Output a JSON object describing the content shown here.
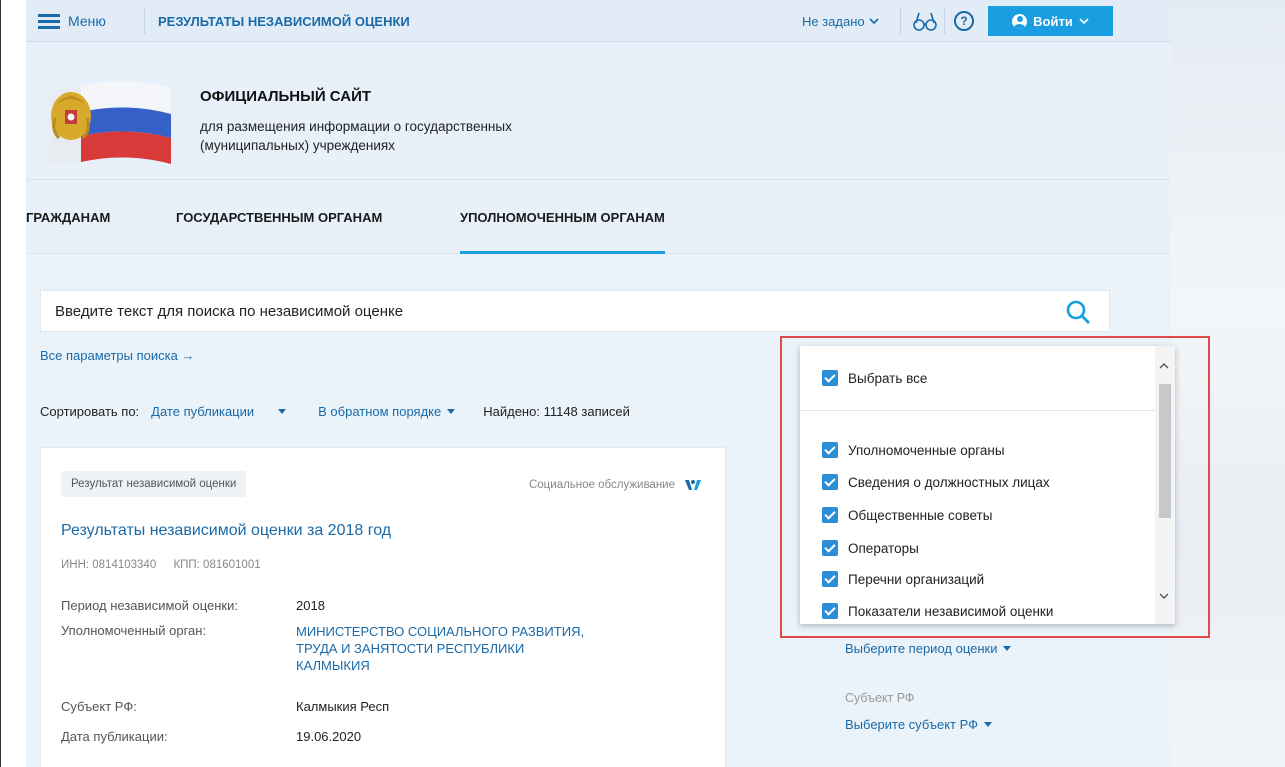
{
  "topbar": {
    "menu_label": "Меню",
    "title": "РЕЗУЛЬТАТЫ НЕЗАВИСИМОЙ ОЦЕНКИ",
    "region": "Не задано",
    "help": "?",
    "login": "Войти"
  },
  "header": {
    "title": "ОФИЦИАЛЬНЫЙ САЙТ",
    "subtitle": "для размещения информации о государственных (муниципальных) учреждениях"
  },
  "nav": [
    "ГРАЖДАНАМ",
    "ГОСУДАРСТВЕННЫМ ОРГАНАМ",
    "УПОЛНОМОЧЕННЫМ ОРГАНАМ"
  ],
  "search": {
    "placeholder": "Введите текст для поиска по независимой оценке",
    "all_params": "Все параметры поиска →"
  },
  "sort": {
    "label": "Сортировать по:",
    "field": "Дате публикации",
    "order": "В обратном порядке",
    "found": "Найдено: 11148 записей"
  },
  "card": {
    "badge": "Результат независимой оценки",
    "category": "Социальное обслуживание",
    "title": "Результаты независимой оценки за 2018 год",
    "inn": "ИНН: 0814103340",
    "kpp": "КПП: 081601001",
    "fields": [
      {
        "label": "Период независимой оценки:",
        "value": "2018"
      },
      {
        "label": "Уполномоченный орган:",
        "value": "МИНИСТЕРСТВО СОЦИАЛЬНОГО РАЗВИТИЯ, ТРУДА И ЗАНЯТОСТИ РЕСПУБЛИКИ КАЛМЫКИЯ"
      },
      {
        "label": "Субъект РФ:",
        "value": "Калмыкия Респ"
      },
      {
        "label": "Дата публикации:",
        "value": "19.06.2020"
      }
    ]
  },
  "filters": {
    "period_link": "Выберите период оценки",
    "subject_label": "Субъект РФ",
    "subject_link": "Выберите субъект РФ"
  },
  "dropdown": {
    "select_all": "Выбрать все",
    "items": [
      "Уполномоченные органы",
      "Сведения о должностных лицах",
      "Общественные советы",
      "Операторы",
      "Перечни организаций",
      "Показатели независимой оценки"
    ]
  },
  "colors": {
    "accent": "#1a9ee2",
    "link": "#1a6aa8",
    "checkbox": "#2b8fd6",
    "highlight": "#e04a48"
  }
}
